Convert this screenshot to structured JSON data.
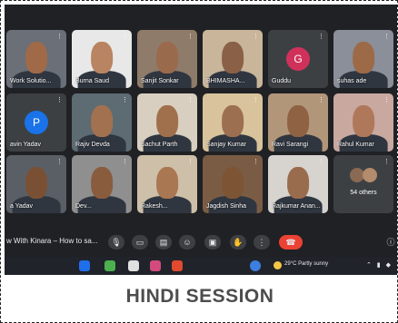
{
  "meeting": {
    "title": "w With Kinara – How to sa...",
    "participants_row1": [
      {
        "name": "Work Solutio...",
        "skin": "#a06a48",
        "bg": "#6a6f78"
      },
      {
        "name": "Burna Saud",
        "skin": "#b88462",
        "bg": "#e8e8e8"
      },
      {
        "name": "Sanjit Sonkar",
        "skin": "#9a6a4c",
        "bg": "#8f7b69"
      },
      {
        "name": "BHIMASHA...",
        "skin": "#8a6046",
        "bg": "#c8b59a"
      },
      {
        "name": "Guddu",
        "avatar_letter": "G",
        "avatar_color": "#d0315a"
      },
      {
        "name": "suhas ade",
        "skin": "#9d6a48",
        "bg": "#8a8f99"
      }
    ],
    "participants_row2": [
      {
        "name": "avin Yadav",
        "avatar_letter": "P",
        "avatar_color": "#1a73e8"
      },
      {
        "name": "Rajiv Devda",
        "skin": "#a2714f",
        "bg": "#5d6b72"
      },
      {
        "name": "Sachut Parth",
        "skin": "#a0704c",
        "bg": "#d9cfc0"
      },
      {
        "name": "Sanjay Kumar",
        "skin": "#9c6f50",
        "bg": "#d8c39c"
      },
      {
        "name": "Ravi Sarangi",
        "skin": "#8f6244",
        "bg": "#b2967a"
      },
      {
        "name": "Rahul Kumar",
        "skin": "#b0785a",
        "bg": "#c9a8a0"
      }
    ],
    "participants_row3": [
      {
        "name": "a Yadav",
        "skin": "#7a5035",
        "bg": "#5a5f66"
      },
      {
        "name": "Dev...",
        "skin": "#8a5c3e",
        "bg": "#8f8f8f"
      },
      {
        "name": "Rakesh...",
        "skin": "#a97752",
        "bg": "#cdbfa8"
      },
      {
        "name": "Jagdish Sinha",
        "skin": "#7d5535",
        "bg": "#7a5c45"
      },
      {
        "name": "Rajkumar Anan...",
        "skin": "#9a6c4e",
        "bg": "#d7d3cf"
      },
      {
        "name": "54 others",
        "is_others": true
      }
    ],
    "controls": [
      "mic",
      "camera",
      "captions",
      "emoji",
      "present",
      "raise-hand",
      "more",
      "end-call"
    ]
  },
  "taskbar": {
    "weather": "29°C  Partly sunny"
  },
  "caption": "HINDI SESSION"
}
